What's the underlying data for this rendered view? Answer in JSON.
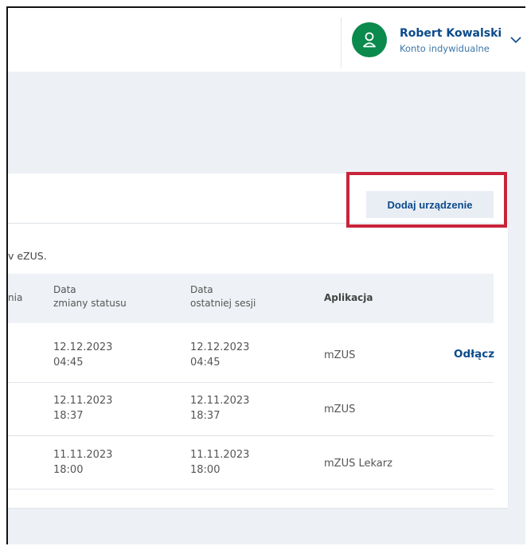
{
  "header": {
    "user_name": "Robert Kowalski",
    "account_type": "Konto indywidualne"
  },
  "card": {
    "add_device_label": "Dodaj urządzenie",
    "intro_text": "v eZUS.",
    "columns": {
      "col1_tail": "nia",
      "status_date_line1": "Data",
      "status_date_line2": "zmiany statusu",
      "session_date_line1": "Data",
      "session_date_line2": "ostatniej sesji",
      "application": "Aplikacja"
    },
    "rows": [
      {
        "status_date": "12.12.2023",
        "status_time": "04:45",
        "session_date": "12.12.2023",
        "session_time": "04:45",
        "app": "mZUS",
        "action": "Odłącz"
      },
      {
        "status_date": "12.11.2023",
        "status_time": "18:37",
        "session_date": "12.11.2023",
        "session_time": "18:37",
        "app": "mZUS",
        "action": ""
      },
      {
        "status_date": "11.11.2023",
        "status_time": "18:00",
        "session_date": "11.11.2023",
        "session_time": "18:00",
        "app": "mZUS Lekarz",
        "action": ""
      }
    ]
  },
  "colors": {
    "brand_blue": "#0b4a8b",
    "avatar_green": "#0a8a4d",
    "highlight_red": "#c8243b"
  },
  "icons": {
    "avatar": "user-icon",
    "dropdown": "chevron-down-icon"
  }
}
